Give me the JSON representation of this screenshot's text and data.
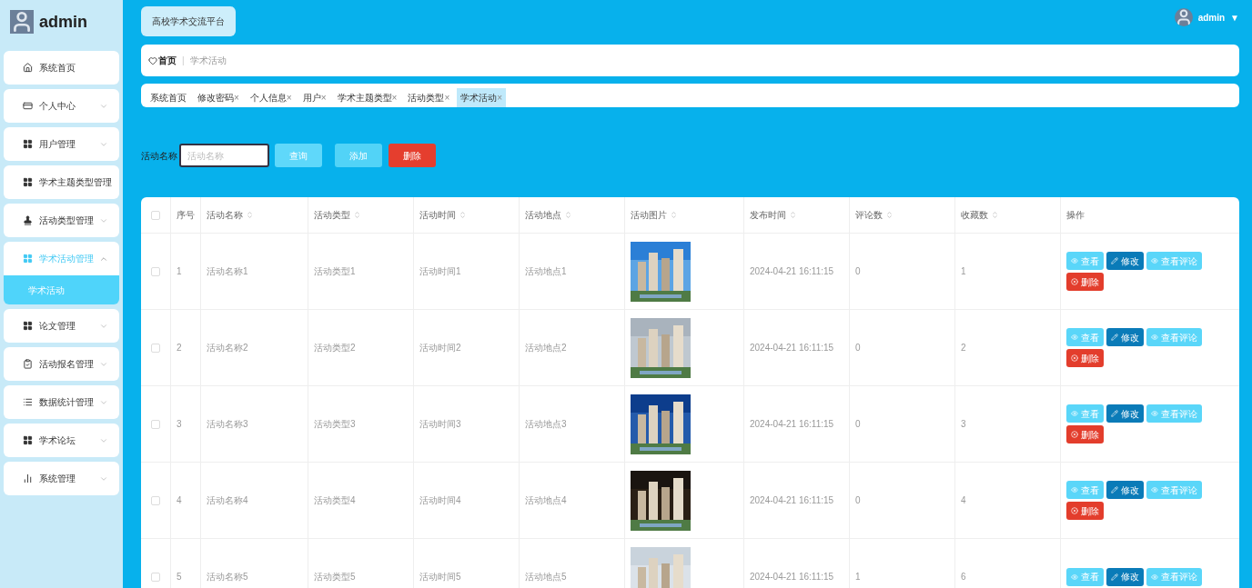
{
  "sidebar": {
    "user": "admin",
    "items": [
      {
        "label": "系统首页",
        "has_menu": false,
        "expanded": false,
        "selected": false
      },
      {
        "label": "个人中心",
        "has_menu": true,
        "expanded": false,
        "selected": false
      },
      {
        "label": "用户管理",
        "has_menu": true,
        "expanded": false,
        "selected": false
      },
      {
        "label": "学术主题类型管理",
        "has_menu": false,
        "expanded": false,
        "selected": false
      },
      {
        "label": "活动类型管理",
        "has_menu": true,
        "expanded": false,
        "selected": false
      },
      {
        "label": "学术活动管理",
        "has_menu": true,
        "expanded": true,
        "selected": true,
        "children": [
          {
            "label": "学术活动",
            "selected": true
          }
        ]
      },
      {
        "label": "论文管理",
        "has_menu": true,
        "expanded": false,
        "selected": false
      },
      {
        "label": "活动报名管理",
        "has_menu": true,
        "expanded": false,
        "selected": false
      },
      {
        "label": "数据统计管理",
        "has_menu": true,
        "expanded": false,
        "selected": false
      },
      {
        "label": "学术论坛",
        "has_menu": true,
        "expanded": false,
        "selected": false
      },
      {
        "label": "系统管理",
        "has_menu": true,
        "expanded": false,
        "selected": false
      }
    ]
  },
  "header": {
    "title": "高校学术交流平台",
    "user": "admin",
    "caret": "▼"
  },
  "breadcrumb": {
    "home": "首页",
    "separator": "|",
    "current": "学术活动"
  },
  "tags": [
    {
      "label": "系统首页",
      "closable": false,
      "selected": false
    },
    {
      "label": "修改密码",
      "closable": true,
      "selected": false
    },
    {
      "label": "个人信息",
      "closable": true,
      "selected": false
    },
    {
      "label": "用户",
      "closable": true,
      "selected": false
    },
    {
      "label": "学术主题类型",
      "closable": true,
      "selected": false
    },
    {
      "label": "活动类型",
      "closable": true,
      "selected": false
    },
    {
      "label": "学术活动",
      "closable": true,
      "selected": true
    }
  ],
  "close_mark": "×",
  "search": {
    "label": "活动名称",
    "placeholder": "活动名称",
    "buttons": [
      {
        "label": "查询",
        "kind": "query"
      },
      {
        "label": "添加",
        "kind": "add"
      },
      {
        "label": "删除",
        "kind": "delete"
      }
    ]
  },
  "table": {
    "all_checked": false,
    "columns": [
      {
        "label": "序号",
        "sortable": false
      },
      {
        "label": "活动名称",
        "sortable": true
      },
      {
        "label": "活动类型",
        "sortable": true
      },
      {
        "label": "活动时间",
        "sortable": true
      },
      {
        "label": "活动地点",
        "sortable": true
      },
      {
        "label": "活动图片",
        "sortable": true
      },
      {
        "label": "发布时间",
        "sortable": true
      },
      {
        "label": "评论数",
        "sortable": true
      },
      {
        "label": "收藏数",
        "sortable": true
      },
      {
        "label": "操作",
        "sortable": false
      }
    ],
    "rows": [
      {
        "checked": false,
        "cells": [
          "1",
          "活动名称1",
          "活动类型1",
          "活动时间1",
          "活动地点1"
        ],
        "published": "2024-04-21 16:11:15",
        "comments": "0",
        "favorites": "1",
        "actions": [
          {
            "label": "查看",
            "kind": "view"
          },
          {
            "label": "修改",
            "kind": "edit"
          },
          {
            "label": "查看评论",
            "kind": "view"
          },
          {
            "label": "删除",
            "kind": "delete"
          }
        ]
      },
      {
        "checked": false,
        "cells": [
          "2",
          "活动名称2",
          "活动类型2",
          "活动时间2",
          "活动地点2"
        ],
        "published": "2024-04-21 16:11:15",
        "comments": "0",
        "favorites": "2",
        "actions": [
          {
            "label": "查看",
            "kind": "view"
          },
          {
            "label": "修改",
            "kind": "edit"
          },
          {
            "label": "查看评论",
            "kind": "view"
          },
          {
            "label": "删除",
            "kind": "delete"
          }
        ]
      },
      {
        "checked": false,
        "cells": [
          "3",
          "活动名称3",
          "活动类型3",
          "活动时间3",
          "活动地点3"
        ],
        "published": "2024-04-21 16:11:15",
        "comments": "0",
        "favorites": "3",
        "actions": [
          {
            "label": "查看",
            "kind": "view"
          },
          {
            "label": "修改",
            "kind": "edit"
          },
          {
            "label": "查看评论",
            "kind": "view"
          },
          {
            "label": "删除",
            "kind": "delete"
          }
        ]
      },
      {
        "checked": false,
        "cells": [
          "4",
          "活动名称4",
          "活动类型4",
          "活动时间4",
          "活动地点4"
        ],
        "published": "2024-04-21 16:11:15",
        "comments": "0",
        "favorites": "4",
        "actions": [
          {
            "label": "查看",
            "kind": "view"
          },
          {
            "label": "修改",
            "kind": "edit"
          },
          {
            "label": "查看评论",
            "kind": "view"
          },
          {
            "label": "删除",
            "kind": "delete"
          }
        ]
      },
      {
        "checked": false,
        "cells": [
          "5",
          "活动名称5",
          "活动类型5",
          "活动时间5",
          "活动地点5"
        ],
        "published": "2024-04-21 16:11:15",
        "comments": "1",
        "favorites": "6",
        "actions": [
          {
            "label": "查看",
            "kind": "view"
          },
          {
            "label": "修改",
            "kind": "edit"
          },
          {
            "label": "查看评论",
            "kind": "view"
          }
        ]
      }
    ]
  }
}
